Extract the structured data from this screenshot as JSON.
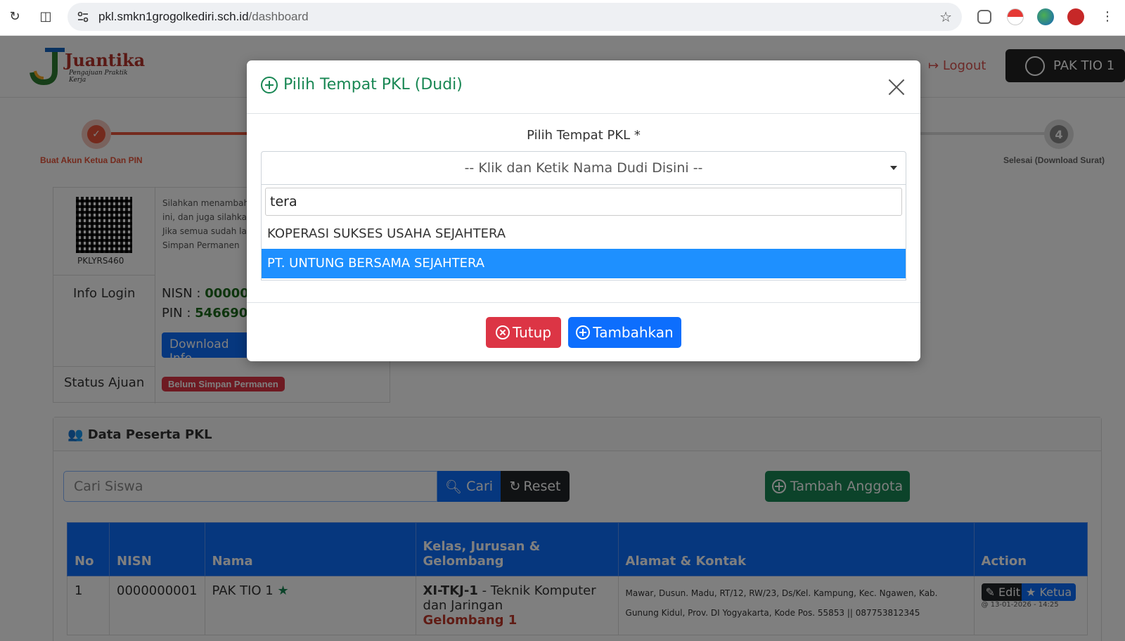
{
  "browser": {
    "url_host": "pkl.smkn1grogolkediri.sch.id",
    "url_path": "/dashboard"
  },
  "header": {
    "logo_text": "Juantika",
    "logo_tagline": "Pengajuan Praktik Kerja",
    "logout_label": "Logout",
    "user_label": "PAK TIO 1"
  },
  "stepper": {
    "step1_label": "Buat Akun Ketua Dan PIN",
    "step4_number": "4",
    "step4_label": "Selesai (Download Surat)"
  },
  "info": {
    "qr_code": "PKLYRS460",
    "instructions": [
      "Silahkan menambah",
      "ini, dan juga silahka",
      "Jika semua sudah la",
      "Simpan Permanen"
    ],
    "login_label": "Info Login",
    "nisn_label": "NISN :",
    "nisn_value": "000000",
    "pin_label": "PIN :",
    "pin_value": "546690",
    "download_label": "Download Info",
    "status_label": "Status Ajuan",
    "status_value": "Belum Simpan Permanen"
  },
  "peserta": {
    "panel_title": "Data Peserta PKL",
    "search_placeholder": "Cari Siswa",
    "cari_label": "Cari",
    "reset_label": "Reset",
    "tambah_anggota_label": "Tambah Anggota",
    "columns": [
      "No",
      "NISN",
      "Nama",
      "Kelas, Jurusan & Gelombang",
      "Alamat & Kontak",
      "Action"
    ],
    "rows": [
      {
        "no": "1",
        "nisn": "0000000001",
        "nama": "PAK TIO 1",
        "kelas": "XI-TKJ-1",
        "jurusan": " - Teknik Komputer dan Jaringan",
        "gelombang": "Gelombang 1",
        "alamat_line1": "Mawar, Dusun. Madu, RT/12, RW/23, Ds/Kel. Kampung, Kec. Ngawen, Kab.",
        "alamat_line2": "Gunung Kidul, Prov. DI Yogyakarta, Kode Pos. 55853 || 087753812345",
        "edit_label": "Edit",
        "ketua_label": "Ketua",
        "timestamp": "@ 13-01-2026 - 14:25"
      }
    ]
  },
  "modal": {
    "title": "Pilih Tempat PKL (Dudi)",
    "field_label": "Pilih Tempat PKL *",
    "select_placeholder": "-- Klik dan Ketik Nama Dudi Disini --",
    "search_value": "tera",
    "options": [
      "KOPERASI SUKSES USAHA SEJAHTERA",
      "PT. UNTUNG BERSAMA SEJAHTERA"
    ],
    "highlighted_option": "PT. UNTUNG BERSAMA SEJAHTERA",
    "close_label": "Tutup",
    "add_label": "Tambahkan"
  },
  "colors": {
    "primary": "#0d6efd",
    "success": "#198754",
    "danger": "#dc3545",
    "highlight": "#1e90ff"
  }
}
